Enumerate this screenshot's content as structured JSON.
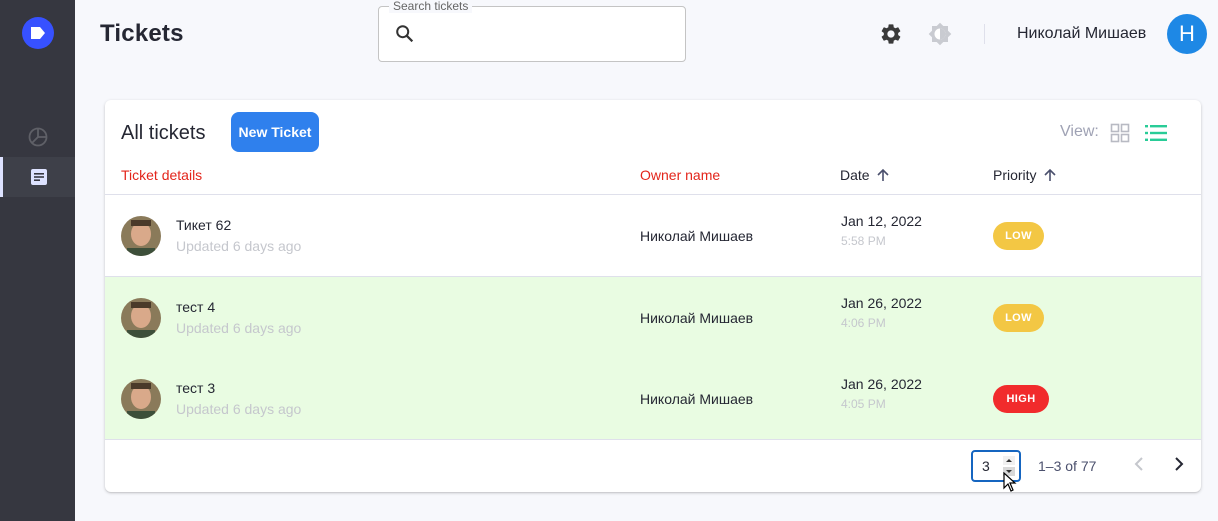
{
  "header": {
    "title": "Tickets",
    "search_label": "Search tickets",
    "search_value": "",
    "user_name": "Николай Мишаев",
    "user_initial": "Н"
  },
  "sidebar": {
    "items": [
      {
        "icon": "pie-chart-icon",
        "active": false
      },
      {
        "icon": "ticket-list-icon",
        "active": true
      }
    ]
  },
  "card": {
    "title": "All tickets",
    "new_button": "New Ticket",
    "view_label": "View:",
    "columns": {
      "details": "Ticket details",
      "owner": "Owner name",
      "date": "Date",
      "priority": "Priority"
    },
    "rows": [
      {
        "title": "Тикет 62",
        "updated": "Updated 6 days ago",
        "owner": "Николай Мишаев",
        "date": "Jan 12, 2022",
        "time": "5:58 PM",
        "priority": "LOW",
        "highlighted": false
      },
      {
        "title": "тест 4",
        "updated": "Updated 6 days ago",
        "owner": "Николай Мишаев",
        "date": "Jan 26, 2022",
        "time": "4:06 PM",
        "priority": "LOW",
        "highlighted": true
      },
      {
        "title": "тест 3",
        "updated": "Updated 6 days ago",
        "owner": "Николай Мишаев",
        "date": "Jan 26, 2022",
        "time": "4:05 PM",
        "priority": "HIGH",
        "highlighted": true
      }
    ],
    "pagination": {
      "rows_per_page": "3",
      "range": "1–3 of 77"
    }
  },
  "colors": {
    "accent": "#2f80ed",
    "low": "#f3c744",
    "high": "#f12b2c",
    "highlight_row": "#e9fce2",
    "sidebar": "#363740"
  }
}
